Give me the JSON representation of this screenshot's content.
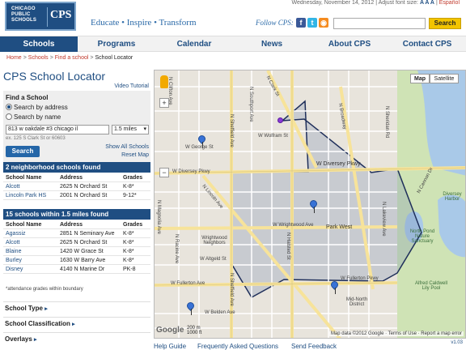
{
  "header": {
    "logo_small": "CHICAGO PUBLIC SCHOOLS",
    "logo_small_l1": "CHICAGO",
    "logo_small_l2": "PUBLIC",
    "logo_small_l3": "SCHOOLS",
    "logo_big": "CPS",
    "tagline": "Educate • Inspire • Transform",
    "date": "Wednesday, November 14, 2012",
    "font_size_label": "Adjust font size:",
    "font_sizes": "A A A",
    "language": "Español",
    "follow_label": "Follow CPS:",
    "search_placeholder": "",
    "search_button": "Search"
  },
  "nav": {
    "items": [
      "Schools",
      "Programs",
      "Calendar",
      "News",
      "About CPS",
      "Contact CPS"
    ],
    "active": "Schools"
  },
  "breadcrumb": [
    "Home",
    "Schools",
    "Find a school",
    "School Locator"
  ],
  "locator": {
    "title": "CPS School Locator",
    "video_tutorial": "Video Tutorial",
    "find_title": "Find a School",
    "search_by_address": "Search by address",
    "search_by_name": "Search by name",
    "address_value": "813 w oakdale #3 chicago il",
    "distance_value": "1.5 miles",
    "address_hint": "ex. 125 S Clark St or 60603",
    "search_button": "Search",
    "show_all": "Show All Schools",
    "reset_map": "Reset Map"
  },
  "neighborhood": {
    "title": "2 neighborhood schools found",
    "headers": [
      "School Name",
      "Address",
      "Grades"
    ],
    "rows": [
      [
        "Alcott",
        "2625 N Orchard St",
        "K-8*"
      ],
      [
        "Lincoln Park HS",
        "2001 N Orchard St",
        "9-12*"
      ]
    ]
  },
  "nearby": {
    "title": "15 schools within 1.5 miles found",
    "headers": [
      "School Name",
      "Address",
      "Grades"
    ],
    "rows": [
      [
        "Agassiz",
        "2851 N Seminary Ave",
        "K-8*"
      ],
      [
        "Alcott",
        "2625 N Orchard St",
        "K-8*"
      ],
      [
        "Blaine",
        "1420 W Grace St",
        "K-8*"
      ],
      [
        "Burley",
        "1630 W Barry Ave",
        "K-8*"
      ],
      [
        "Disney",
        "4140 N Marine Dr",
        "PK-8"
      ]
    ],
    "footnote": "*attendance grades within boundary"
  },
  "filters": [
    "School Type",
    "School Classification",
    "Overlays"
  ],
  "map": {
    "map_button": "Map",
    "satellite_button": "Satellite",
    "zoom_in": "+",
    "zoom_out": "−",
    "streets": {
      "clark": "N Clark St",
      "diversey": "W Diversey Pkwy",
      "diversey_east": "W Diversey Pkwy",
      "wrightwood": "W Wrightwood Ave",
      "fullerton": "W Fullerton Ave",
      "fullerton_pkwy": "W Fullerton Pkwy",
      "belden": "W Belden Ave",
      "wolfram": "W Wolfram St",
      "george": "W George St",
      "lincoln": "N Lincoln Ave",
      "halsted": "N Halsted St",
      "sheffield": "N Sheffield Ave",
      "racine": "N Racine Ave",
      "broadway": "N Broadway",
      "sheridan": "N Sheridan Rd",
      "lakeview": "N Lakeview Ave",
      "cannon": "N Cannon Dr",
      "altgeld": "W Altgeld St",
      "clifton": "N Clifton Ave",
      "magnolia": "N Magnolia Ave",
      "southport": "N Southport Ave"
    },
    "areas": {
      "wrightwood_neighbors": "Wrightwood Neighbors",
      "park_west": "Park West",
      "mid_north": "Mid-North District",
      "north_pond": "North Pond Nature Sanctuary",
      "diversey_harbor": "Diversey Harbor",
      "alfred_caldwell": "Alfred Caldwell Lily Pool"
    },
    "scale_m": "200 m",
    "scale_ft": "1000 ft",
    "google": "Google",
    "credit": "Map data ©2012 Google · Terms of Use · Report a map error"
  },
  "version": "v1.03",
  "footer": [
    "Help Guide",
    "Frequently Asked Questions",
    "Send Feedback"
  ]
}
